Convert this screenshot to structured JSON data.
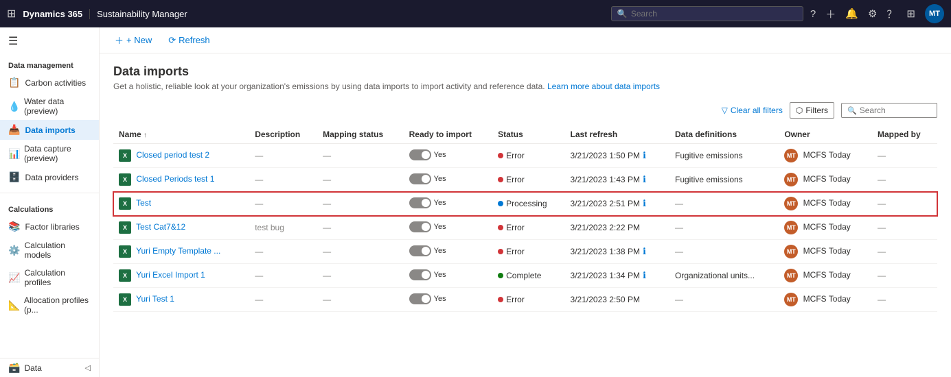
{
  "topNav": {
    "logo": "Dynamics 365",
    "app": "Sustainability Manager",
    "searchPlaceholder": "Search",
    "avatarLabel": "MT"
  },
  "sidebar": {
    "hamburgerIcon": "☰",
    "sections": [
      {
        "title": "Data management",
        "items": [
          {
            "id": "carbon-activities",
            "label": "Carbon activities",
            "icon": "📋",
            "active": false
          },
          {
            "id": "water-data",
            "label": "Water data (preview)",
            "icon": "💧",
            "active": false
          },
          {
            "id": "data-imports",
            "label": "Data imports",
            "icon": "📥",
            "active": true
          },
          {
            "id": "data-capture",
            "label": "Data capture (preview)",
            "icon": "📊",
            "active": false
          },
          {
            "id": "data-providers",
            "label": "Data providers",
            "icon": "🗄️",
            "active": false
          }
        ]
      },
      {
        "title": "Calculations",
        "items": [
          {
            "id": "factor-libraries",
            "label": "Factor libraries",
            "icon": "📚",
            "active": false
          },
          {
            "id": "calculation-models",
            "label": "Calculation models",
            "icon": "⚙️",
            "active": false
          },
          {
            "id": "calculation-profiles",
            "label": "Calculation profiles",
            "icon": "📈",
            "active": false
          },
          {
            "id": "allocation-profiles",
            "label": "Allocation profiles (p...",
            "icon": "📐",
            "active": false
          }
        ]
      }
    ],
    "bottomItem": {
      "label": "Data",
      "icon": "🗃️"
    }
  },
  "toolbar": {
    "newLabel": "+ New",
    "refreshLabel": "⟳ Refresh"
  },
  "page": {
    "title": "Data imports",
    "description": "Get a holistic, reliable look at your organization's emissions by using data imports to import activity and reference data.",
    "learnMoreText": "Learn more about data imports",
    "learnMoreUrl": "#"
  },
  "filterBar": {
    "clearFiltersLabel": "Clear all filters",
    "filtersLabel": "Filters",
    "searchPlaceholder": "Search"
  },
  "table": {
    "columns": [
      {
        "id": "name",
        "label": "Name",
        "sortable": true
      },
      {
        "id": "description",
        "label": "Description"
      },
      {
        "id": "mappingStatus",
        "label": "Mapping status"
      },
      {
        "id": "readyToImport",
        "label": "Ready to import"
      },
      {
        "id": "status",
        "label": "Status"
      },
      {
        "id": "lastRefresh",
        "label": "Last refresh"
      },
      {
        "id": "dataDefinitions",
        "label": "Data definitions"
      },
      {
        "id": "owner",
        "label": "Owner"
      },
      {
        "id": "mappedBy",
        "label": "Mapped by"
      }
    ],
    "rows": [
      {
        "id": "row-1",
        "name": "Closed period test 2",
        "description": "—",
        "mappingStatus": "—",
        "readyToImport": "Yes",
        "status": "Error",
        "statusType": "error",
        "hasInfo": true,
        "lastRefresh": "3/21/2023 1:50 PM",
        "dataDefinitions": "Fugitive emissions",
        "ownerInitials": "MT",
        "ownerName": "MCFS Today",
        "ownerColor": "orange",
        "mappedBy": "—",
        "selected": false
      },
      {
        "id": "row-2",
        "name": "Closed Periods test 1",
        "description": "—",
        "mappingStatus": "—",
        "readyToImport": "Yes",
        "status": "Error",
        "statusType": "error",
        "hasInfo": true,
        "lastRefresh": "3/21/2023 1:43 PM",
        "dataDefinitions": "Fugitive emissions",
        "ownerInitials": "MT",
        "ownerName": "MCFS Today",
        "ownerColor": "orange",
        "mappedBy": "—",
        "selected": false
      },
      {
        "id": "row-3",
        "name": "Test",
        "description": "—",
        "mappingStatus": "—",
        "readyToImport": "Yes",
        "status": "Processing",
        "statusType": "processing",
        "hasInfo": true,
        "lastRefresh": "3/21/2023 2:51 PM",
        "dataDefinitions": "—",
        "ownerInitials": "MT",
        "ownerName": "MCFS Today",
        "ownerColor": "orange",
        "mappedBy": "—",
        "selected": true
      },
      {
        "id": "row-4",
        "name": "Test Cat7&12",
        "description": "test bug",
        "mappingStatus": "—",
        "readyToImport": "Yes",
        "status": "Error",
        "statusType": "error",
        "hasInfo": false,
        "lastRefresh": "3/21/2023 2:22 PM",
        "dataDefinitions": "—",
        "ownerInitials": "MT",
        "ownerName": "MCFS Today",
        "ownerColor": "orange",
        "mappedBy": "—",
        "selected": false
      },
      {
        "id": "row-5",
        "name": "Yuri Empty Template ...",
        "description": "—",
        "mappingStatus": "—",
        "readyToImport": "Yes",
        "status": "Error",
        "statusType": "error",
        "hasInfo": true,
        "lastRefresh": "3/21/2023 1:38 PM",
        "dataDefinitions": "—",
        "ownerInitials": "MT",
        "ownerName": "MCFS Today",
        "ownerColor": "orange",
        "mappedBy": "—",
        "selected": false
      },
      {
        "id": "row-6",
        "name": "Yuri Excel Import 1",
        "description": "—",
        "mappingStatus": "—",
        "readyToImport": "Yes",
        "status": "Complete",
        "statusType": "complete",
        "hasInfo": true,
        "lastRefresh": "3/21/2023 1:34 PM",
        "dataDefinitions": "Organizational units...",
        "ownerInitials": "MT",
        "ownerName": "MCFS Today",
        "ownerColor": "orange",
        "mappedBy": "—",
        "selected": false
      },
      {
        "id": "row-7",
        "name": "Yuri Test 1",
        "description": "—",
        "mappingStatus": "—",
        "readyToImport": "Yes",
        "status": "Error",
        "statusType": "error",
        "hasInfo": false,
        "lastRefresh": "3/21/2023 2:50 PM",
        "dataDefinitions": "—",
        "ownerInitials": "MT",
        "ownerName": "MCFS Today",
        "ownerColor": "orange",
        "mappedBy": "—",
        "selected": false
      }
    ]
  }
}
